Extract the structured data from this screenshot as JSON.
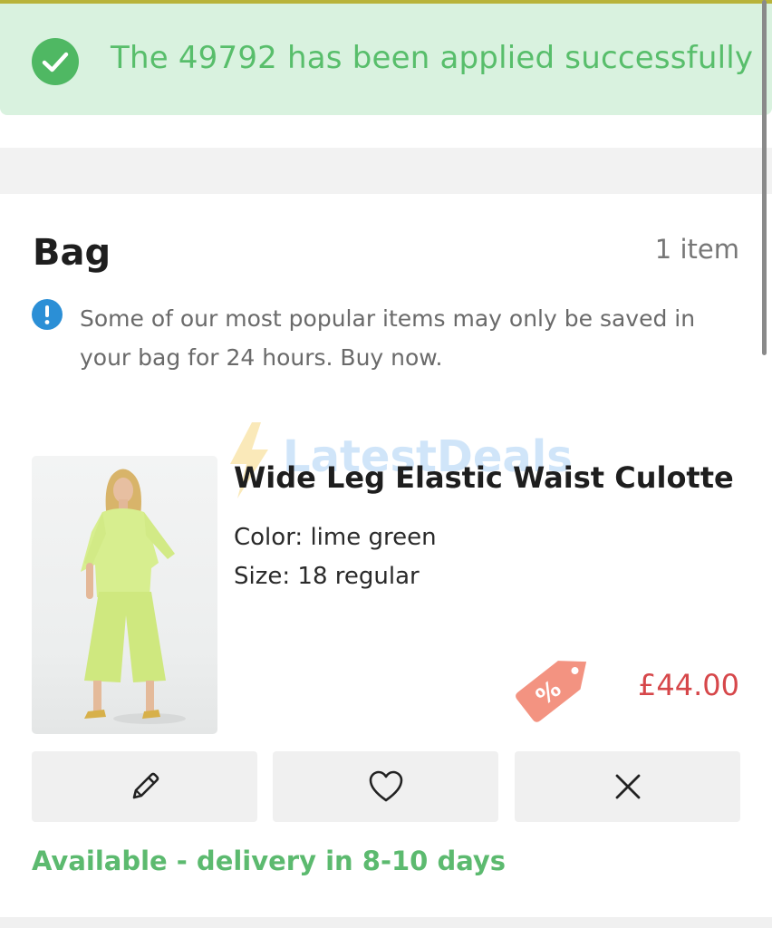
{
  "toast": {
    "message": "The 49792 has been applied successfully",
    "icon": "check-circle-icon",
    "color": "#58be6b"
  },
  "bag": {
    "title": "Bag",
    "count_label": "1 item",
    "notice": "Some of our most popular items may only be saved in your bag for 24 hours. Buy now.",
    "notice_icon": "info-icon"
  },
  "watermark": {
    "text": "LatestDeals"
  },
  "product": {
    "name": "Wide Leg Elastic Waist Culotte",
    "color_label": "Color: lime green",
    "size_label": "Size: 18 regular",
    "price": "£44.00",
    "price_color": "#d6474a",
    "discount_icon": "percent-tag-icon"
  },
  "actions": {
    "edit_icon": "pencil-icon",
    "wishlist_icon": "heart-icon",
    "remove_icon": "close-icon"
  },
  "availability": "Available - delivery in 8-10 days"
}
